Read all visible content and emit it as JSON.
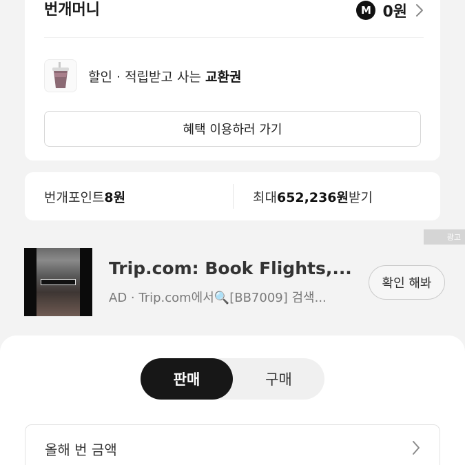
{
  "money": {
    "title": "번개머니",
    "badge": "M",
    "amount": "0원"
  },
  "voucher": {
    "prefix": "할인 · 적립받고 사는 ",
    "highlight": "교환권"
  },
  "benefit_button": "혜택 이용하러 가기",
  "points": {
    "label": "번개포인트 ",
    "value": "8원",
    "max_prefix": "최대 ",
    "max_value": "652,236원",
    "max_suffix": " 받기"
  },
  "ad": {
    "tag": "광고",
    "title": "Trip.com: Book Flights,...",
    "subtitle": "AD · Trip.com에서🔍[BB7009] 검색...",
    "button": "확인 해봐"
  },
  "tabs": [
    {
      "label": "판매",
      "active": true
    },
    {
      "label": "구매",
      "active": false
    }
  ],
  "annual": {
    "label": "올해 번 금액"
  },
  "colors": {
    "accent_dark": "#171717",
    "panel_bg": "#ffffff",
    "page_bg": "#f3f3f3"
  }
}
